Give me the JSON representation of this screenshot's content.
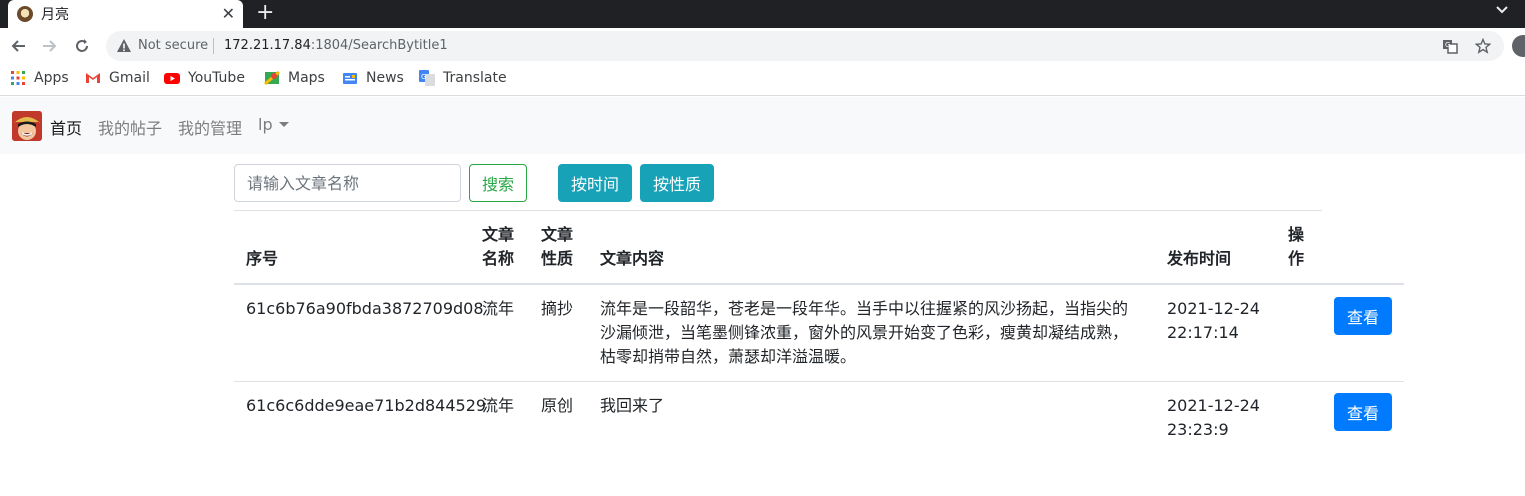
{
  "browser": {
    "tab_title": "月亮",
    "security_label": "Not secure",
    "url_host": "172.21.17.84",
    "url_rest": ":1804/SearchBytitle1",
    "bookmarks": [
      "Apps",
      "Gmail",
      "YouTube",
      "Maps",
      "News",
      "Translate"
    ]
  },
  "navbar": {
    "links": [
      "首页",
      "我的帖子",
      "我的管理",
      "lp"
    ]
  },
  "search": {
    "placeholder": "请输入文章名称",
    "search_label": "搜索",
    "by_time_label": "按时间",
    "by_type_label": "按性质"
  },
  "table": {
    "headers": {
      "id": "序号",
      "name_l1": "文章",
      "name_l2": "名称",
      "type_l1": "文章",
      "type_l2": "性质",
      "content": "文章内容",
      "time": "发布时间",
      "op_l1": "操",
      "op_l2": "作"
    },
    "rows": [
      {
        "id": "61c6b76a90fbda3872709d08",
        "name": "流年",
        "type": "摘抄",
        "content_l1": "流年是一段韶华，苍老是一段年华。当手中以往握紧的风沙扬起，当指尖的",
        "content_l2": "沙漏倾泄，当笔墨侧锋浓重，窗外的风景开始变了色彩，瘦黄却凝结成熟，",
        "content_l3": "枯零却捎带自然，萧瑟却洋溢温暖。",
        "date": "2021-12-24",
        "time": "22:17:14",
        "view_label": "查看"
      },
      {
        "id": "61c6c6dde9eae71b2d844529",
        "name": "流年",
        "type": "原创",
        "content_l1": "我回来了",
        "date": "2021-12-24",
        "time": "23:23:9",
        "view_label": "查看"
      }
    ]
  }
}
